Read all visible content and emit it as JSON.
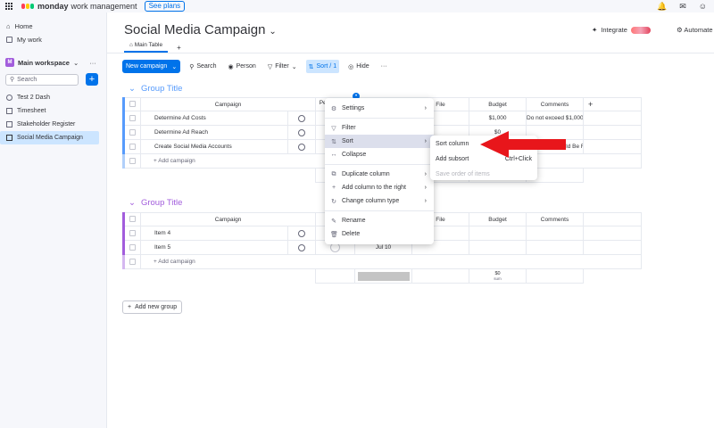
{
  "topbar": {
    "brand": "monday",
    "product": "work management",
    "see_plans": "See plans"
  },
  "sidebar": {
    "home": "Home",
    "my_work": "My work",
    "workspace_initial": "M",
    "workspace": "Main workspace",
    "search_placeholder": "Search",
    "boards": [
      "Test 2 Dash",
      "Timesheet",
      "Stakeholder Register",
      "Social Media Campaign"
    ]
  },
  "board": {
    "title": "Social Media Campaign",
    "integrate": "Integrate",
    "automate": "Automate",
    "tab_main": "Main Table",
    "tab_add": "+"
  },
  "toolbar": {
    "new_item": "New campaign",
    "search": "Search",
    "person": "Person",
    "filter": "Filter",
    "sort": "Sort / 1",
    "hide": "Hide",
    "more": "···"
  },
  "columns": {
    "campaign": "Campaign",
    "person": "Person",
    "file": "File",
    "budget": "Budget",
    "comments": "Comments",
    "add": "+"
  },
  "groups": [
    {
      "title": "Group Title",
      "rows": [
        {
          "campaign": "Determine Ad Costs",
          "budget": "$1,000",
          "comments": "Do not exceed $1,000",
          "date": ""
        },
        {
          "campaign": "Determine Ad Reach",
          "budget": "$0",
          "comments": "",
          "date": ""
        },
        {
          "campaign": "Create Social Media Accounts",
          "budget": "",
          "comments": "Soc Acts Should Be Free",
          "date": ""
        }
      ],
      "add_item": "+ Add campaign"
    },
    {
      "title": "Group Title",
      "rows": [
        {
          "campaign": "Item 4",
          "budget": "",
          "comments": "",
          "date": ""
        },
        {
          "campaign": "Item 5",
          "budget": "",
          "comments": "",
          "date": "Jul 10"
        }
      ],
      "add_item": "+ Add campaign",
      "sum_value": "$0",
      "sum_label": "sum"
    }
  ],
  "add_group": "Add new group",
  "context_menu": {
    "settings": "Settings",
    "filter": "Filter",
    "sort": "Sort",
    "collapse": "Collapse",
    "duplicate": "Duplicate column",
    "add_right": "Add column to the right",
    "change_type": "Change column type",
    "rename": "Rename",
    "delete": "Delete"
  },
  "sort_submenu": {
    "sort_column": "Sort column",
    "add_subsort": "Add subsort",
    "add_subsort_shortcut": "Ctrl+Click",
    "save_order": "Save order of items"
  },
  "colors": {
    "accent": "#0073ea",
    "group1": "#579bfc",
    "group2": "#a25ddc",
    "arrow": "#e8161b"
  }
}
